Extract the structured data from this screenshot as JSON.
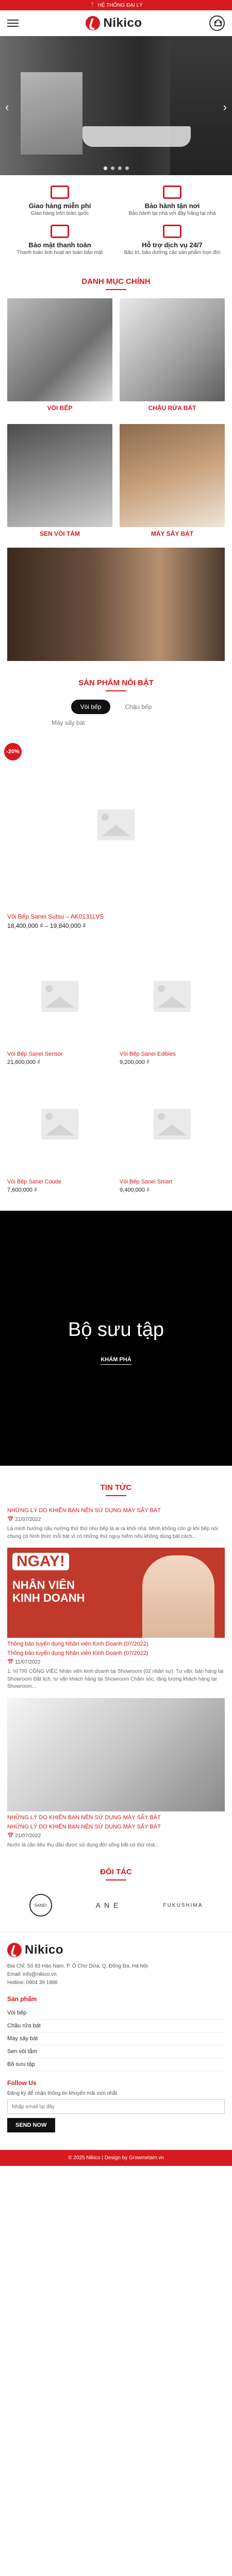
{
  "topbar": {
    "text": "HỆ THỐNG ĐẠI LÝ"
  },
  "header": {
    "logo_text": "Nikico"
  },
  "benefits": [
    {
      "title": "Giao hàng miễn phí",
      "desc": "Giao hàng trên toàn quốc"
    },
    {
      "title": "Bảo hành tận nơi",
      "desc": "Bảo hành tại nhà với đầy hãng tại nhà"
    },
    {
      "title": "Bảo mật thanh toán",
      "desc": "Thanh toán linh hoạt an toàn bảo mật"
    },
    {
      "title": "Hỗ trợ dịch vụ 24/7",
      "desc": "Bảo trì, bảo dưỡng các sản phẩm trọn đời"
    }
  ],
  "categories": {
    "title": "DANH MỤC CHÍNH",
    "items": [
      {
        "label": "VÒI BẾP"
      },
      {
        "label": "CHẬU RỬA BÁT"
      },
      {
        "label": "SEN VÒI TẮM"
      },
      {
        "label": "MÁY SẤY BÁT"
      }
    ]
  },
  "featured": {
    "title": "SẢN PHẨM NỔI BẬT",
    "tabs": [
      "Vòi bếp",
      "Chậu bếp",
      "Máy sấy bát"
    ],
    "big": {
      "badge": "-20%",
      "name": "Vòi Bếp Sanei Sutsu – AK0131LVS",
      "price": "18,400,000 ₫ – 19,840,000 ₫"
    },
    "grid": [
      {
        "name": "Vòi Bếp Sanei Sensor",
        "price": "21,600,000 ₫"
      },
      {
        "name": "Vòi Bếp Sanei Edibles",
        "price": "9,200,000 ₫"
      },
      {
        "name": "Vòi Bếp Sanei Coude",
        "price": "7,600,000 ₫"
      },
      {
        "name": "Vòi Bếp Sanei Smart",
        "price": "9,400,000 ₫"
      }
    ]
  },
  "collection": {
    "title": "Bộ sưu tập",
    "cta": "KHÁM PHÁ"
  },
  "news": {
    "title": "TIN TỨC",
    "items": [
      {
        "title": "NHỮNG LÝ DO KHIẾN BẠN NÊN SỬ DỤNG MÁY SẤY BÁT",
        "date": "21/07/2022",
        "excerpt": "Là minh hướng nấu nướng thứ thứ như bếp là ai ra khỏi nhà. Mình không còn gì khi bếp nói chung có hình thức mỗi bát vì có những thứ nguy hiểm nếu không dùng bát cách..."
      },
      {
        "banner_ngay": "NGAY!",
        "banner_line1": "NHÂN VIÊN",
        "banner_line2": "KINH DOANH",
        "title": "Thông báo tuyển dụng Nhân viên Kinh Doanh (07/2022)",
        "sub": "Thông báo tuyển dụng Nhân viên Kinh Doanh (07/2022)",
        "date": "11/07/2022",
        "excerpt": "1. VỊ TRÍ CÔNG VIỆC Nhân viên kinh doanh tại Showroom (02 nhân sự). Tư vấn, bán hàng tại Showroom Đặt lịch, tư vấn khách hàng tại Showroom Chăm sóc, tăng lượng khách hàng tại Showroom..."
      },
      {
        "title": "NHỮNG LÝ DO KHIẾN BẠN NÊN SỬ DỤNG MÁY SẤY BÁT",
        "sub": "NHỮNG LÝ DO KHIẾN BẠN NÊN SỬ DỤNG MÁY SẤY BÁT",
        "date": "21/07/2022",
        "excerpt": "Nước là cần tiêu thụ dầu được sử dụng đời sống bất cứ thứ nhà..."
      }
    ]
  },
  "partners": {
    "title": "ĐỐI TÁC",
    "items": [
      "SANEI",
      "A N E",
      "FUKUSHIMA"
    ]
  },
  "footer": {
    "logo_text": "Nikico",
    "address": "Địa Chỉ: Số 83 Hào Nam, P. Ô Chợ Dừa, Q. Đống Đa, Hà Nội",
    "email": "Email: info@nikico.vn",
    "hotline": "Hotline: 0904 39 1986",
    "product_heading": "Sản phẩm",
    "links": [
      "Vòi bếp",
      "Chậu rửa bát",
      "Máy sấy bát",
      "Sen vòi tắm",
      "Bồ sưu tập"
    ],
    "follow_heading": "Follow Us",
    "follow_note": "Đăng ký để nhận thông tin khuyến mãi mới nhất",
    "email_placeholder": "Nhập email tại đây",
    "send_label": "SEND NOW",
    "copyright": "© 2025 Nikico | Design by Growmetam.vn"
  }
}
